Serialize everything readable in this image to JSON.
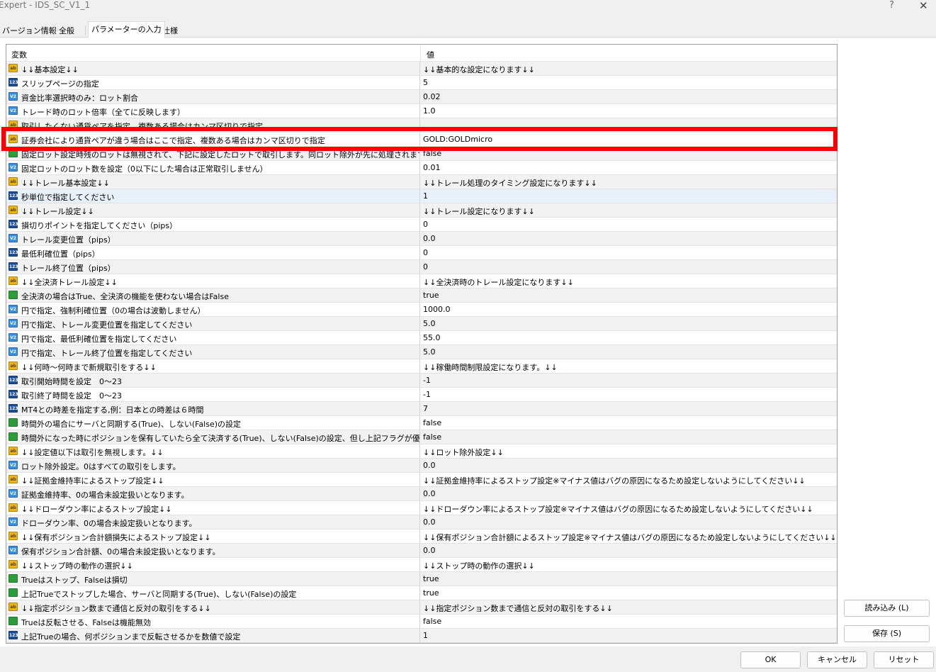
{
  "window": {
    "title": "Expert - IDS_SC_V1_1",
    "help": "?",
    "close": "✕"
  },
  "tabs": [
    {
      "label": "バージョン情報"
    },
    {
      "label": "全般"
    },
    {
      "label": "パラメーターの入力"
    },
    {
      "label": "仕様"
    }
  ],
  "grid": {
    "col_variable": "変数",
    "col_value": "値",
    "rows": [
      {
        "icon": "ab",
        "name": "↓↓基本設定↓↓",
        "value": "↓↓基本的な設定になります↓↓"
      },
      {
        "icon": "123",
        "name": "スリップページの指定",
        "value": "5"
      },
      {
        "icon": "v2",
        "name": "資金比率選択時のみ：ロット割合",
        "value": "0.02"
      },
      {
        "icon": "v2",
        "name": "トレード時のロット倍率（全てに反映します）",
        "value": "1.0"
      },
      {
        "icon": "ab",
        "name": "取引したくない通貨ペアを指定、複数ある場合はカンマ区切りで指定",
        "value": ""
      },
      {
        "icon": "ab",
        "name": "証券会社により通貨ペアが違う場合はここで指定、複数ある場合はカンマ区切りで指定",
        "value": "GOLD:GOLDmicro"
      },
      {
        "icon": "bool",
        "name": "固定ロット設定時残のロットは無視されて、下記に設定したロットで取引します。同ロット除外が先に処理されます。",
        "value": "false"
      },
      {
        "icon": "v2",
        "name": "固定ロットのロット数を設定（0以下にした場合は正常取引しません）",
        "value": "0.01"
      },
      {
        "icon": "ab",
        "name": "↓↓トレール基本設定↓↓",
        "value": "↓↓トレール処理のタイミング設定になります↓↓"
      },
      {
        "icon": "123",
        "name": "秒単位で指定してください",
        "value": "1"
      },
      {
        "icon": "ab",
        "name": "↓↓トレール設定↓↓",
        "value": "↓↓トレール設定になります↓↓"
      },
      {
        "icon": "123",
        "name": "損切りポイントを指定してください（pips）",
        "value": "0"
      },
      {
        "icon": "v2",
        "name": "トレール変更位置（pips）",
        "value": "0.0"
      },
      {
        "icon": "123",
        "name": "最低利確位置（pips）",
        "value": "0"
      },
      {
        "icon": "123",
        "name": "トレール終了位置（pips）",
        "value": "0"
      },
      {
        "icon": "ab",
        "name": "↓↓全決済トレール設定↓↓",
        "value": "↓↓全決済時のトレール設定になります↓↓"
      },
      {
        "icon": "bool",
        "name": "全決済の場合はTrue、全決済の機能を使わない場合はFalse",
        "value": "true"
      },
      {
        "icon": "v2",
        "name": "円で指定、強制利確位置（0の場合は波動しません）",
        "value": "1000.0"
      },
      {
        "icon": "v2",
        "name": "円で指定、トレール変更位置を指定してください",
        "value": "5.0"
      },
      {
        "icon": "v2",
        "name": "円で指定、最低利確位置を指定してください",
        "value": "55.0"
      },
      {
        "icon": "v2",
        "name": "円で指定、トレール終了位置を指定してください",
        "value": "5.0"
      },
      {
        "icon": "ab",
        "name": "↓↓何時〜何時まで新規取引をする↓↓",
        "value": "↓↓稼働時間制限設定になります。↓↓"
      },
      {
        "icon": "123",
        "name": "取引開始時間を設定　0〜23",
        "value": "-1"
      },
      {
        "icon": "123",
        "name": "取引終了時間を設定　0〜23",
        "value": "-1"
      },
      {
        "icon": "123",
        "name": "MT4との時差を指定する,例：日本との時差は６時間",
        "value": "7"
      },
      {
        "icon": "bool",
        "name": "時間外の場合にサーバと同期する(True)、しない(False)の設定",
        "value": "false"
      },
      {
        "icon": "bool",
        "name": "時間外になった時にポジションを保有していたら全て決済する(True)、しない(False)の設定、但し上記フラグが優先され…",
        "value": "false"
      },
      {
        "icon": "ab",
        "name": "↓↓設定値以下は取引を無視します。↓↓",
        "value": "↓↓ロット除外設定↓↓"
      },
      {
        "icon": "v2",
        "name": "ロット除外設定。0はすべての取引をします。",
        "value": "0.0"
      },
      {
        "icon": "ab",
        "name": "↓↓証拠金維持率によるストップ設定↓↓",
        "value": "↓↓証拠金維持率によるストップ設定※マイナス値はバグの原因になるため設定しないようにしてください↓↓"
      },
      {
        "icon": "v2",
        "name": "証拠金維持率、0の場合未設定扱いとなります。",
        "value": "0.0"
      },
      {
        "icon": "ab",
        "name": "↓↓ドローダウン率によるストップ設定↓↓",
        "value": "↓↓ドローダウン率によるストップ設定※マイナス値はバグの原因になるため設定しないようにしてください↓↓"
      },
      {
        "icon": "v2",
        "name": "ドローダウン率、0の場合未設定扱いとなります。",
        "value": "0.0"
      },
      {
        "icon": "ab",
        "name": "↓↓保有ポジション合計額損失によるストップ設定↓↓",
        "value": "↓↓保有ポジション合計額によるストップ設定※マイナス値はバグの原因になるため設定しないようにしてください↓↓"
      },
      {
        "icon": "v2",
        "name": "保有ポジション合計額、0の場合未設定扱いとなります。",
        "value": "0.0"
      },
      {
        "icon": "ab",
        "name": "↓↓ストップ時の動作の選択↓↓",
        "value": "↓↓ストップ時の動作の選択↓↓"
      },
      {
        "icon": "bool",
        "name": "Trueはストップ、Falseは損切",
        "value": "true"
      },
      {
        "icon": "bool",
        "name": "上記Trueでストップした場合、サーバと同期する(True)、しない(False)の設定",
        "value": "true"
      },
      {
        "icon": "ab",
        "name": "↓↓指定ポジション数まで通信と反対の取引をする↓↓",
        "value": "↓↓指定ポジション数まで通信と反対の取引をする↓↓"
      },
      {
        "icon": "bool",
        "name": "Trueは反転させる、Falseは機能無効",
        "value": "false"
      },
      {
        "icon": "123",
        "name": "上記Trueの場合、何ポジションまで反転させるかを数値で設定",
        "value": "1"
      }
    ]
  },
  "icon_labels": {
    "ab": "ab",
    "123": "123",
    "v2": "V2",
    "bool": ""
  },
  "buttons": {
    "load": "読み込み (L)",
    "save": "保存 (S)",
    "ok": "OK",
    "cancel": "キャンセル",
    "reset": "リセット"
  },
  "colors": {
    "highlight": "#ff0000",
    "selected_row": "#e8f0fa"
  }
}
